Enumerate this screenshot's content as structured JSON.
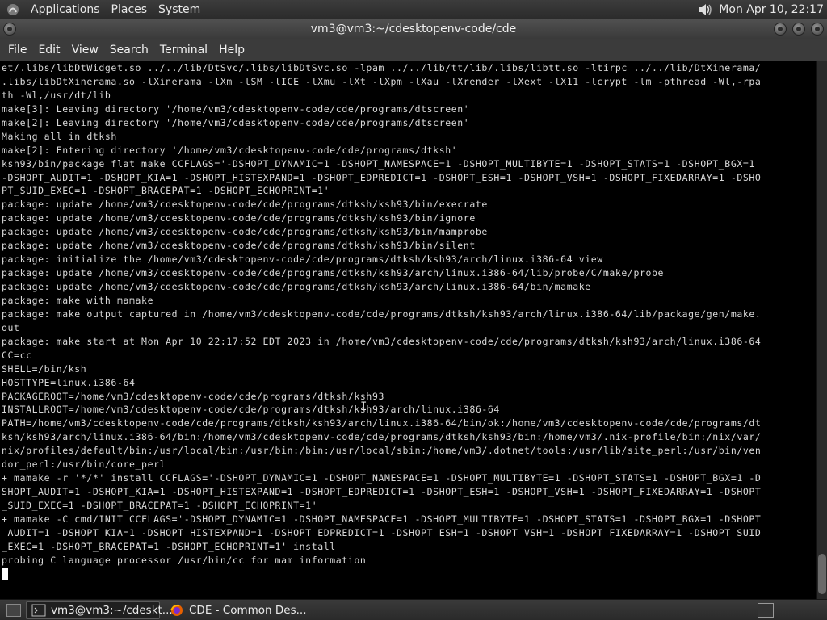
{
  "top_panel": {
    "menus": [
      "Applications",
      "Places",
      "System"
    ],
    "clock": "Mon Apr 10, 22:17",
    "volume_icon": "speaker-icon"
  },
  "window": {
    "title": "vm3@vm3:~/cdesktopenv-code/cde",
    "buttons": [
      "minimize",
      "maximize",
      "close"
    ]
  },
  "menubar": {
    "items": [
      "File",
      "Edit",
      "View",
      "Search",
      "Terminal",
      "Help"
    ]
  },
  "terminal": {
    "lines": [
      "et/.libs/libDtWidget.so ../../lib/DtSvc/.libs/libDtSvc.so -lpam ../../lib/tt/lib/.libs/libtt.so -ltirpc ../../lib/DtXinerama/",
      ".libs/libDtXinerama.so -lXinerama -lXm -lSM -lICE -lXmu -lXt -lXpm -lXau -lXrender -lXext -lX11 -lcrypt -lm -pthread -Wl,-rpa",
      "th -Wl,/usr/dt/lib",
      "make[3]: Leaving directory '/home/vm3/cdesktopenv-code/cde/programs/dtscreen'",
      "make[2]: Leaving directory '/home/vm3/cdesktopenv-code/cde/programs/dtscreen'",
      "Making all in dtksh",
      "make[2]: Entering directory '/home/vm3/cdesktopenv-code/cde/programs/dtksh'",
      "ksh93/bin/package flat make CCFLAGS='-DSHOPT_DYNAMIC=1 -DSHOPT_NAMESPACE=1 -DSHOPT_MULTIBYTE=1 -DSHOPT_STATS=1 -DSHOPT_BGX=1",
      "-DSHOPT_AUDIT=1 -DSHOPT_KIA=1 -DSHOPT_HISTEXPAND=1 -DSHOPT_EDPREDICT=1 -DSHOPT_ESH=1 -DSHOPT_VSH=1 -DSHOPT_FIXEDARRAY=1 -DSHO",
      "PT_SUID_EXEC=1 -DSHOPT_BRACEPAT=1 -DSHOPT_ECHOPRINT=1'",
      "package: update /home/vm3/cdesktopenv-code/cde/programs/dtksh/ksh93/bin/execrate",
      "package: update /home/vm3/cdesktopenv-code/cde/programs/dtksh/ksh93/bin/ignore",
      "package: update /home/vm3/cdesktopenv-code/cde/programs/dtksh/ksh93/bin/mamprobe",
      "package: update /home/vm3/cdesktopenv-code/cde/programs/dtksh/ksh93/bin/silent",
      "package: initialize the /home/vm3/cdesktopenv-code/cde/programs/dtksh/ksh93/arch/linux.i386-64 view",
      "package: update /home/vm3/cdesktopenv-code/cde/programs/dtksh/ksh93/arch/linux.i386-64/lib/probe/C/make/probe",
      "package: update /home/vm3/cdesktopenv-code/cde/programs/dtksh/ksh93/arch/linux.i386-64/bin/mamake",
      "package: make with mamake",
      "package: make output captured in /home/vm3/cdesktopenv-code/cde/programs/dtksh/ksh93/arch/linux.i386-64/lib/package/gen/make.",
      "out",
      "package: make start at Mon Apr 10 22:17:52 EDT 2023 in /home/vm3/cdesktopenv-code/cde/programs/dtksh/ksh93/arch/linux.i386-64",
      "CC=cc",
      "SHELL=/bin/ksh",
      "HOSTTYPE=linux.i386-64",
      "PACKAGEROOT=/home/vm3/cdesktopenv-code/cde/programs/dtksh/ksh93",
      "INSTALLROOT=/home/vm3/cdesktopenv-code/cde/programs/dtksh/ksh93/arch/linux.i386-64",
      "PATH=/home/vm3/cdesktopenv-code/cde/programs/dtksh/ksh93/arch/linux.i386-64/bin/ok:/home/vm3/cdesktopenv-code/cde/programs/dt",
      "ksh/ksh93/arch/linux.i386-64/bin:/home/vm3/cdesktopenv-code/cde/programs/dtksh/ksh93/bin:/home/vm3/.nix-profile/bin:/nix/var/",
      "nix/profiles/default/bin:/usr/local/bin:/usr/bin:/bin:/usr/local/sbin:/home/vm3/.dotnet/tools:/usr/lib/site_perl:/usr/bin/ven",
      "dor_perl:/usr/bin/core_perl",
      "+ mamake -r '*/*' install CCFLAGS='-DSHOPT_DYNAMIC=1 -DSHOPT_NAMESPACE=1 -DSHOPT_MULTIBYTE=1 -DSHOPT_STATS=1 -DSHOPT_BGX=1 -D",
      "SHOPT_AUDIT=1 -DSHOPT_KIA=1 -DSHOPT_HISTEXPAND=1 -DSHOPT_EDPREDICT=1 -DSHOPT_ESH=1 -DSHOPT_VSH=1 -DSHOPT_FIXEDARRAY=1 -DSHOPT",
      "_SUID_EXEC=1 -DSHOPT_BRACEPAT=1 -DSHOPT_ECHOPRINT=1'",
      "+ mamake -C cmd/INIT CCFLAGS='-DSHOPT_DYNAMIC=1 -DSHOPT_NAMESPACE=1 -DSHOPT_MULTIBYTE=1 -DSHOPT_STATS=1 -DSHOPT_BGX=1 -DSHOPT",
      "_AUDIT=1 -DSHOPT_KIA=1 -DSHOPT_HISTEXPAND=1 -DSHOPT_EDPREDICT=1 -DSHOPT_ESH=1 -DSHOPT_VSH=1 -DSHOPT_FIXEDARRAY=1 -DSHOPT_SUID",
      "_EXEC=1 -DSHOPT_BRACEPAT=1 -DSHOPT_ECHOPRINT=1' install",
      "probing C language processor /usr/bin/cc for mam information",
      ""
    ]
  },
  "taskbar": {
    "tasks": [
      {
        "label": "vm3@vm3:~/cdeskt...",
        "icon": "terminal-icon",
        "active": true
      },
      {
        "label": "CDE - Common Des...",
        "icon": "firefox-icon",
        "active": false
      }
    ]
  },
  "colors": {
    "panel_bg": "#2f2f2f",
    "terminal_bg": "#000000",
    "terminal_fg": "#d8d8d8"
  }
}
